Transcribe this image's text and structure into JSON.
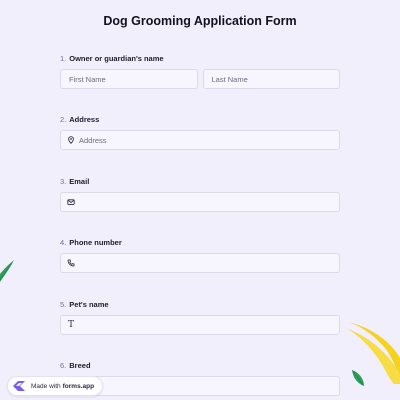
{
  "form": {
    "title": "Dog Grooming Application Form",
    "questions": [
      {
        "number": "1.",
        "label": "Owner or guardian's name",
        "first_placeholder": "First Name",
        "last_placeholder": "Last Name"
      },
      {
        "number": "2.",
        "label": "Address",
        "placeholder": "Address",
        "icon": "location-pin-icon"
      },
      {
        "number": "3.",
        "label": "Email",
        "placeholder": "",
        "icon": "envelope-icon"
      },
      {
        "number": "4.",
        "label": "Phone number",
        "placeholder": "",
        "icon": "phone-icon"
      },
      {
        "number": "5.",
        "label": "Pet's name",
        "placeholder": "",
        "icon": "text-t-icon"
      },
      {
        "number": "6.",
        "label": "Breed",
        "placeholder": ""
      }
    ]
  },
  "badge": {
    "prefix": "Made with",
    "brand": "forms.app"
  },
  "colors": {
    "background": "#f1effb",
    "field_background": "#f7f6fe",
    "field_border": "#dcd8ee",
    "leaf_green": "#2e9e5b",
    "leaf_yellow": "#f5d21f"
  }
}
